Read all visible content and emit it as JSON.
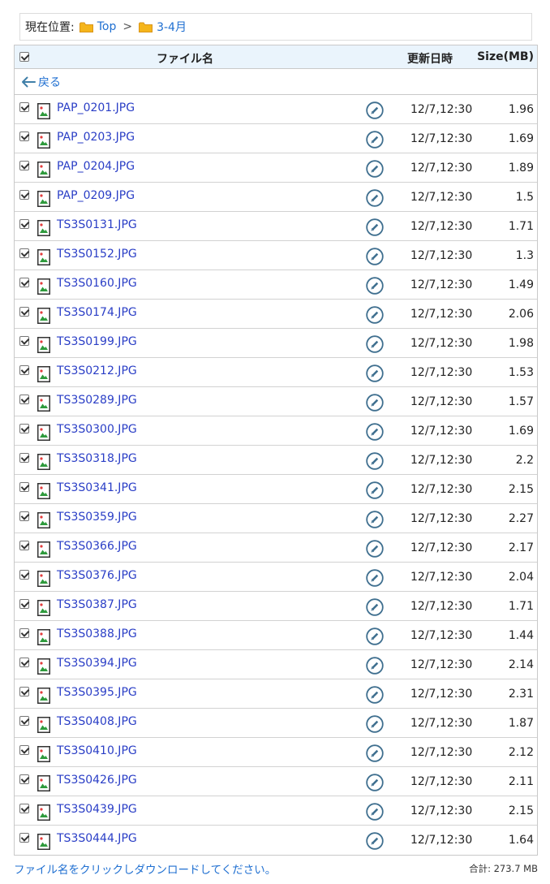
{
  "breadcrumb": {
    "label": "現在位置:",
    "items": [
      {
        "label": "Top",
        "icon": "folder-icon"
      },
      {
        "label": "3-4月",
        "icon": "folder-icon"
      }
    ],
    "separator": ">"
  },
  "table": {
    "headers": {
      "name": "ファイル名",
      "date": "更新日時",
      "size": "Size(MB)"
    },
    "back_label": "戻る",
    "rows": [
      {
        "name": "PAP_0201.JPG",
        "date": "12/7,12:30",
        "size": "1.96"
      },
      {
        "name": "PAP_0203.JPG",
        "date": "12/7,12:30",
        "size": "1.69"
      },
      {
        "name": "PAP_0204.JPG",
        "date": "12/7,12:30",
        "size": "1.89"
      },
      {
        "name": "PAP_0209.JPG",
        "date": "12/7,12:30",
        "size": "1.5"
      },
      {
        "name": "TS3S0131.JPG",
        "date": "12/7,12:30",
        "size": "1.71"
      },
      {
        "name": "TS3S0152.JPG",
        "date": "12/7,12:30",
        "size": "1.3"
      },
      {
        "name": "TS3S0160.JPG",
        "date": "12/7,12:30",
        "size": "1.49"
      },
      {
        "name": "TS3S0174.JPG",
        "date": "12/7,12:30",
        "size": "2.06"
      },
      {
        "name": "TS3S0199.JPG",
        "date": "12/7,12:30",
        "size": "1.98"
      },
      {
        "name": "TS3S0212.JPG",
        "date": "12/7,12:30",
        "size": "1.53"
      },
      {
        "name": "TS3S0289.JPG",
        "date": "12/7,12:30",
        "size": "1.57"
      },
      {
        "name": "TS3S0300.JPG",
        "date": "12/7,12:30",
        "size": "1.69"
      },
      {
        "name": "TS3S0318.JPG",
        "date": "12/7,12:30",
        "size": "2.2"
      },
      {
        "name": "TS3S0341.JPG",
        "date": "12/7,12:30",
        "size": "2.15"
      },
      {
        "name": "TS3S0359.JPG",
        "date": "12/7,12:30",
        "size": "2.27"
      },
      {
        "name": "TS3S0366.JPG",
        "date": "12/7,12:30",
        "size": "2.17"
      },
      {
        "name": "TS3S0376.JPG",
        "date": "12/7,12:30",
        "size": "2.04"
      },
      {
        "name": "TS3S0387.JPG",
        "date": "12/7,12:30",
        "size": "1.71"
      },
      {
        "name": "TS3S0388.JPG",
        "date": "12/7,12:30",
        "size": "1.44"
      },
      {
        "name": "TS3S0394.JPG",
        "date": "12/7,12:30",
        "size": "2.14"
      },
      {
        "name": "TS3S0395.JPG",
        "date": "12/7,12:30",
        "size": "2.31"
      },
      {
        "name": "TS3S0408.JPG",
        "date": "12/7,12:30",
        "size": "1.87"
      },
      {
        "name": "TS3S0410.JPG",
        "date": "12/7,12:30",
        "size": "2.12"
      },
      {
        "name": "TS3S0426.JPG",
        "date": "12/7,12:30",
        "size": "2.11"
      },
      {
        "name": "TS3S0439.JPG",
        "date": "12/7,12:30",
        "size": "2.15"
      },
      {
        "name": "TS3S0444.JPG",
        "date": "12/7,12:30",
        "size": "1.64"
      }
    ]
  },
  "footer": {
    "note": "ファイル名をクリックしダウンロードしてください。",
    "total": "合計: 273.7 MB"
  },
  "colors": {
    "link": "#2a3ec6",
    "accent_blue": "#1f6fd1",
    "header_bg": "#eaf4fc",
    "folder": "#f5b51b",
    "edit_icon": "#3f6f8f"
  }
}
